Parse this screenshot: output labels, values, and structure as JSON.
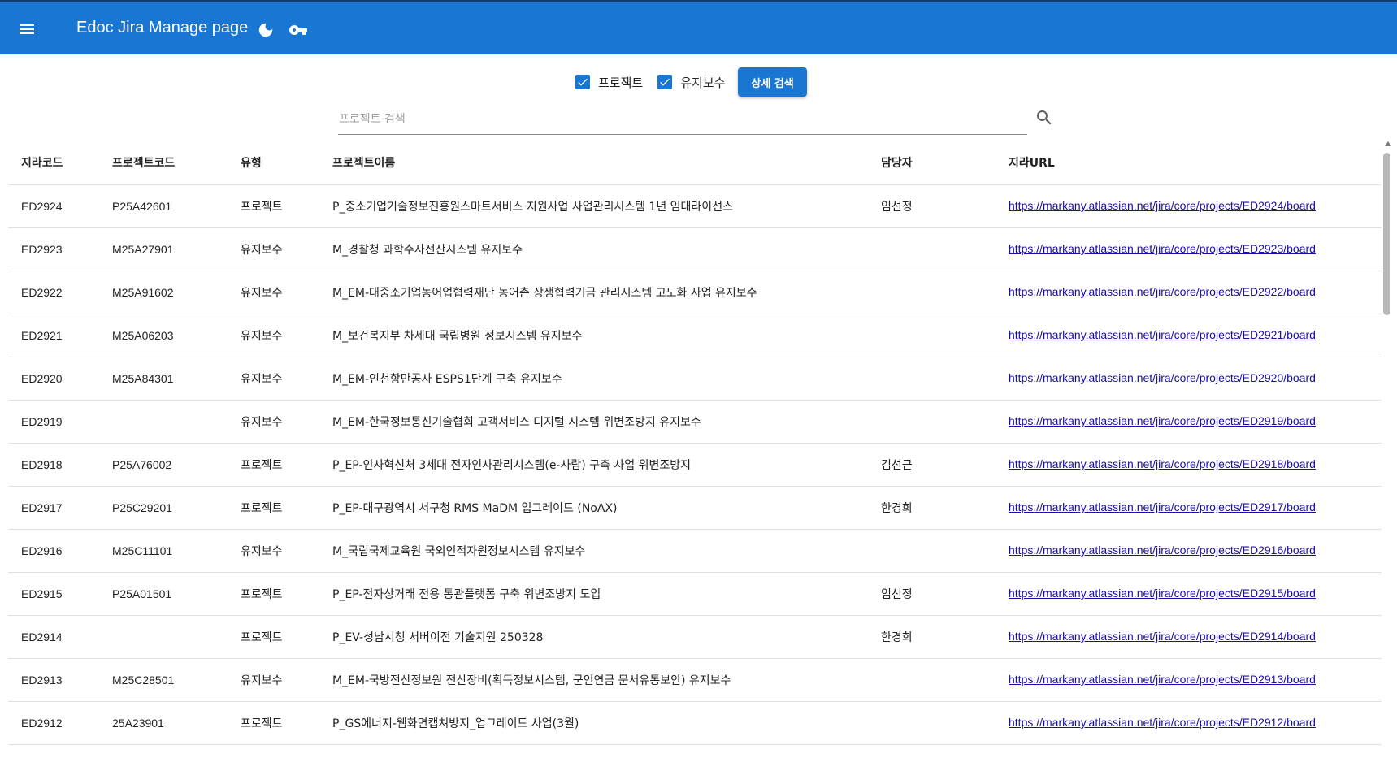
{
  "header": {
    "title": "Edoc Jira Manage page",
    "menu_icon": "menu-icon",
    "theme_icon": "moon-icon",
    "key_icon": "key-icon",
    "bg_color": "#1976d2"
  },
  "filters": {
    "project_label": "프로젝트",
    "project_checked": true,
    "maintenance_label": "유지보수",
    "maintenance_checked": true,
    "detail_button": "상세 검색"
  },
  "search": {
    "placeholder": "프로젝트 검색",
    "value": "",
    "icon": "search-icon"
  },
  "table": {
    "columns": [
      "지라코드",
      "프로젝트코드",
      "유형",
      "프로젝트이름",
      "담당자",
      "지라URL"
    ],
    "rows": [
      [
        "ED2924",
        "P25A42601",
        "프로젝트",
        "P_중소기업기술정보진흥원스마트서비스 지원사업 사업관리시스템 1년 임대라이선스",
        "임선정",
        "https://markany.atlassian.net/jira/core/projects/ED2924/board"
      ],
      [
        "ED2923",
        "M25A27901",
        "유지보수",
        "M_경찰청 과학수사전산시스템 유지보수",
        "",
        "https://markany.atlassian.net/jira/core/projects/ED2923/board"
      ],
      [
        "ED2922",
        "M25A91602",
        "유지보수",
        "M_EM-대중소기업농어업협력재단 농어촌 상생협력기금 관리시스템 고도화 사업 유지보수",
        "",
        "https://markany.atlassian.net/jira/core/projects/ED2922/board"
      ],
      [
        "ED2921",
        "M25A06203",
        "유지보수",
        "M_보건복지부 차세대 국립병원 정보시스템 유지보수",
        "",
        "https://markany.atlassian.net/jira/core/projects/ED2921/board"
      ],
      [
        "ED2920",
        "M25A84301",
        "유지보수",
        "M_EM-인천항만공사 ESPS1단계 구축 유지보수",
        "",
        "https://markany.atlassian.net/jira/core/projects/ED2920/board"
      ],
      [
        "ED2919",
        "",
        "유지보수",
        "M_EM-한국정보통신기술협회 고객서비스 디지털 시스템 위변조방지 유지보수",
        "",
        "https://markany.atlassian.net/jira/core/projects/ED2919/board"
      ],
      [
        "ED2918",
        "P25A76002",
        "프로젝트",
        "P_EP-인사혁신처 3세대 전자인사관리시스템(e-사람) 구축 사업 위변조방지",
        "김선근",
        "https://markany.atlassian.net/jira/core/projects/ED2918/board"
      ],
      [
        "ED2917",
        "P25C29201",
        "프로젝트",
        "P_EP-대구광역시 서구청 RMS MaDM 업그레이드 (NoAX)",
        "한경희",
        "https://markany.atlassian.net/jira/core/projects/ED2917/board"
      ],
      [
        "ED2916",
        "M25C11101",
        "유지보수",
        "M_국립국제교육원 국외인적자원정보시스템 유지보수",
        "",
        "https://markany.atlassian.net/jira/core/projects/ED2916/board"
      ],
      [
        "ED2915",
        "P25A01501",
        "프로젝트",
        "P_EP-전자상거래 전용 통관플랫폼 구축 위변조방지 도입",
        "임선정",
        "https://markany.atlassian.net/jira/core/projects/ED2915/board"
      ],
      [
        "ED2914",
        "",
        "프로젝트",
        "P_EV-성남시청 서버이전 기술지원 250328",
        "한경희",
        "https://markany.atlassian.net/jira/core/projects/ED2914/board"
      ],
      [
        "ED2913",
        "M25C28501",
        "유지보수",
        "M_EM-국방전산정보원 전산장비(획득정보시스템, 군인연금 문서유통보안) 유지보수",
        "",
        "https://markany.atlassian.net/jira/core/projects/ED2913/board"
      ],
      [
        "ED2912",
        "25A23901",
        "프로젝트",
        "P_GS에너지-웹화면캡쳐방지_업그레이드 사업(3월)",
        "",
        "https://markany.atlassian.net/jira/core/projects/ED2912/board"
      ]
    ]
  }
}
